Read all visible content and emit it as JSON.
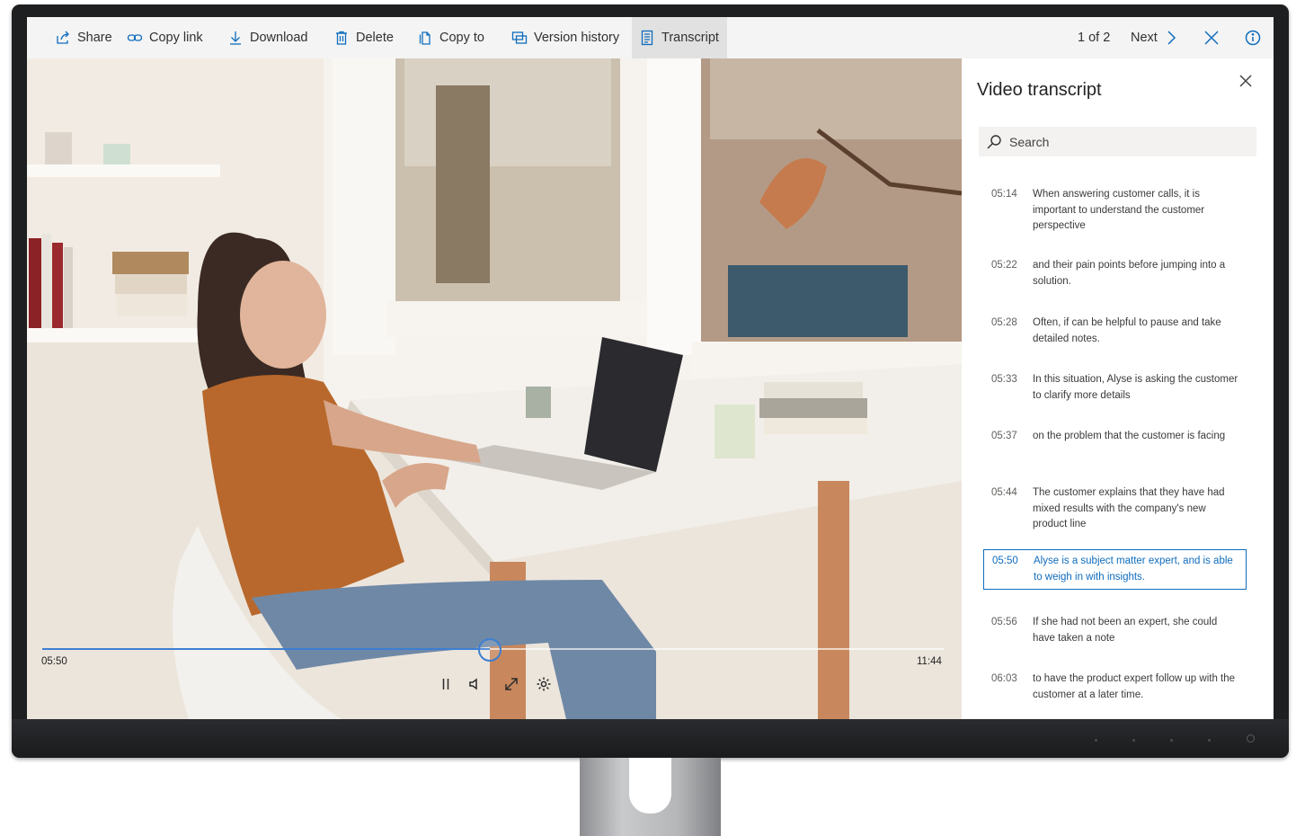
{
  "toolbar": {
    "share": "Share",
    "copy_link": "Copy link",
    "download": "Download",
    "delete": "Delete",
    "copy_to": "Copy to",
    "version_history": "Version history",
    "transcript": "Transcript",
    "pager": "1 of 2",
    "next": "Next"
  },
  "player": {
    "current_time": "05:50",
    "total_time": "11:44",
    "progress": 0.497
  },
  "transcript": {
    "title": "Video transcript",
    "search_placeholder": "Search",
    "entries": [
      {
        "time": "05:14",
        "text": "When answering customer calls, it is important to understand the customer perspective"
      },
      {
        "time": "05:22",
        "text": "and their pain points before jumping into a solution."
      },
      {
        "time": "05:28",
        "text": "Often, if can be helpful to pause and take detailed notes."
      },
      {
        "time": "05:33",
        "text": "In this situation, Alyse is asking the customer to clarify more details"
      },
      {
        "time": "05:37",
        "text": "on the problem that the customer is facing"
      },
      {
        "time": "05:44",
        "text": "The customer explains that they have had mixed results with the company's new product line"
      },
      {
        "time": "05:50",
        "text": "Alyse is a subject matter expert, and is able to weigh in with insights."
      },
      {
        "time": "05:56",
        "text": "If she had not been an expert, she could have taken a note"
      },
      {
        "time": "06:03",
        "text": "to have the product expert follow up with the customer at a later time."
      }
    ],
    "active_index": 6
  },
  "colors": {
    "accent": "#0f6cbd",
    "scrubber": "#3d7fd2"
  }
}
